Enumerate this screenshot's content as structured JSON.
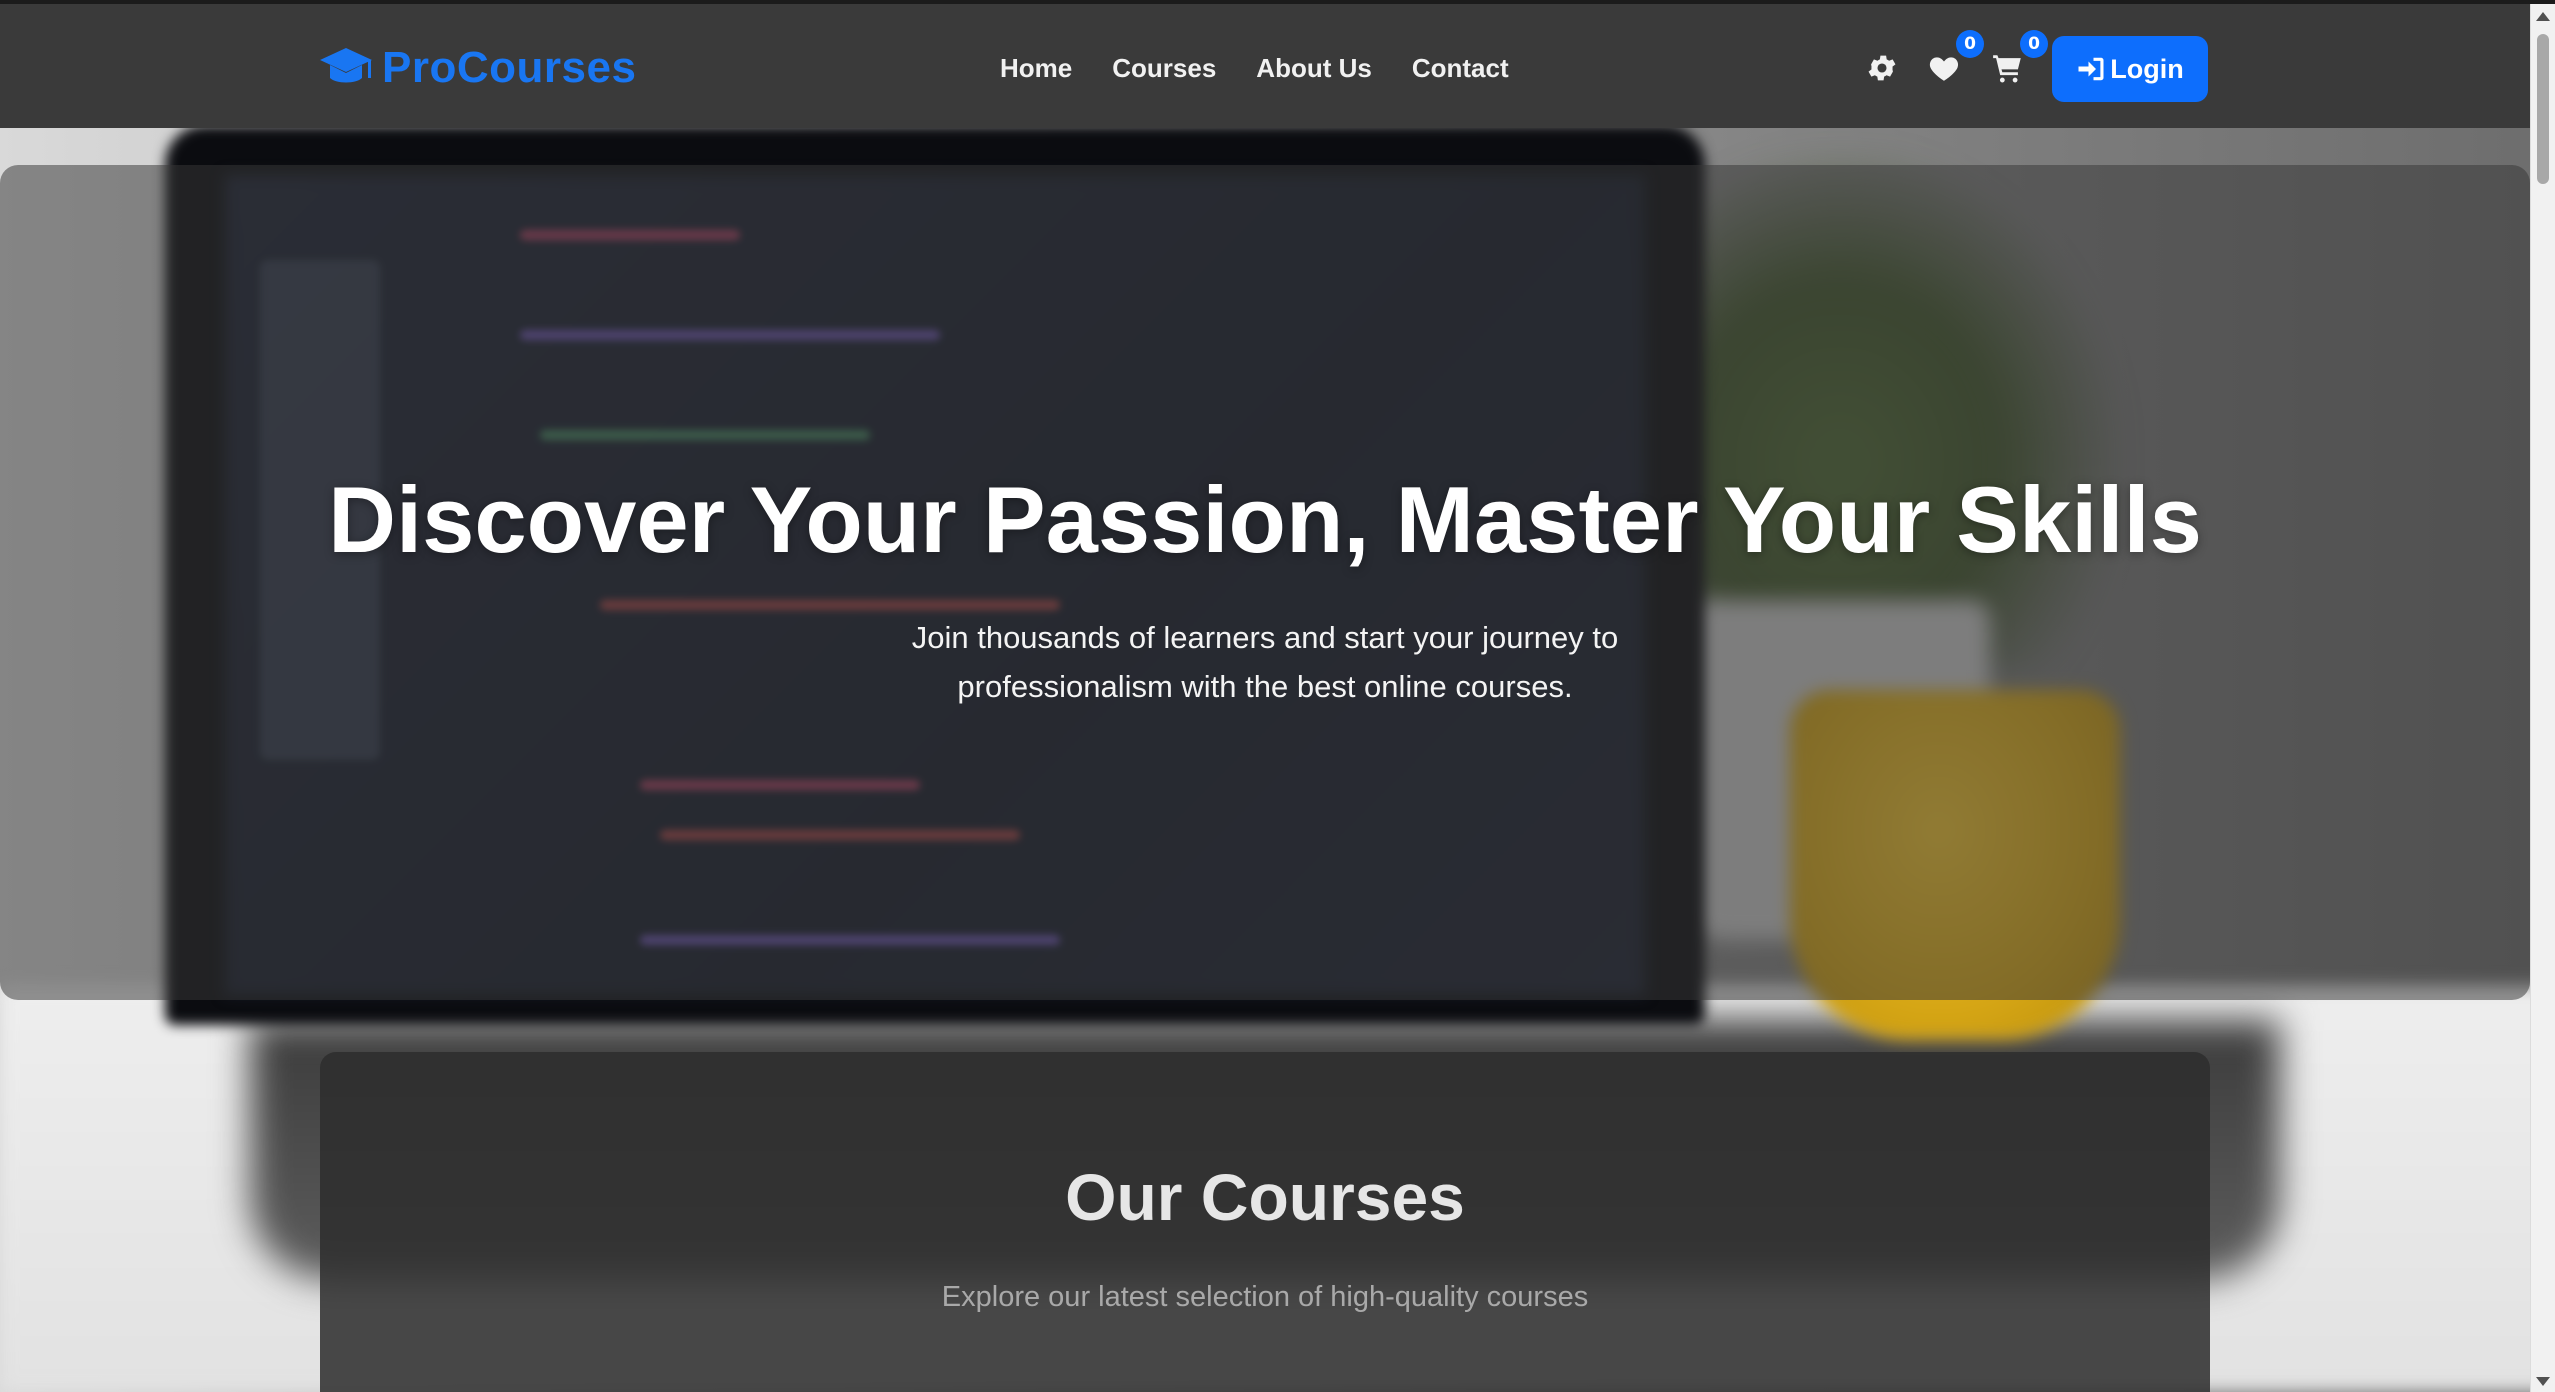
{
  "brand": {
    "name": "ProCourses",
    "icon": "graduation-cap-icon",
    "color": "#1976f2"
  },
  "nav": {
    "links": [
      {
        "label": "Home"
      },
      {
        "label": "Courses"
      },
      {
        "label": "About Us"
      },
      {
        "label": "Contact"
      }
    ],
    "icons": {
      "theme": "gear-icon",
      "wishlist": {
        "icon": "heart-icon",
        "count": "0"
      },
      "cart": {
        "icon": "cart-icon",
        "count": "0"
      }
    },
    "login": {
      "label": "Login",
      "icon": "sign-in-icon",
      "color": "#0d6efd"
    }
  },
  "hero": {
    "title": "Discover Your Passion, Master Your Skills",
    "subtitle": "Join thousands of learners and start your journey to professionalism with the best online courses."
  },
  "courses": {
    "title": "Our Courses",
    "subtitle": "Explore our latest selection of high-quality courses"
  }
}
